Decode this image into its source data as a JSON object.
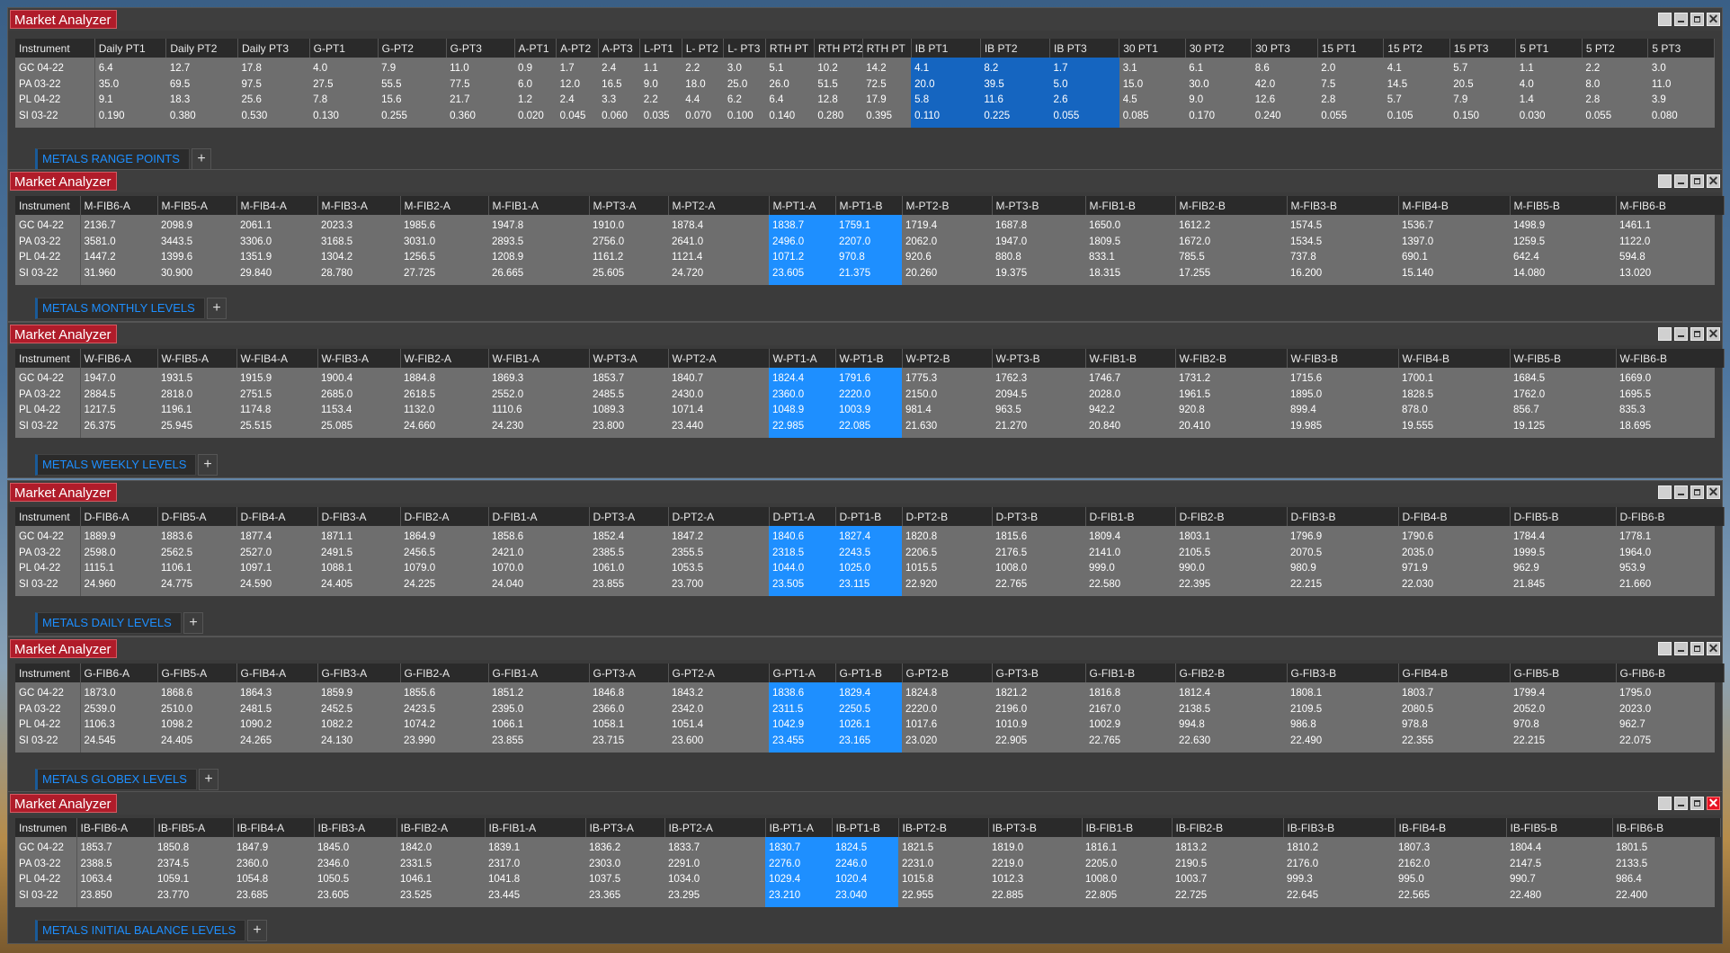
{
  "app_title": "Market Analyzer",
  "instrument_header": "Instrument",
  "instruments": [
    "GC 04-22",
    "PA 03-22",
    "PL 04-22",
    "SI 03-22"
  ],
  "colors": {
    "title_red": "#b01c2a",
    "highlight_blue": "#1e8fff",
    "highlight_dark_blue": "#1565c0",
    "tab_text": "#1e8fff"
  },
  "windows": [
    {
      "title": "Market Analyzer",
      "tab": "METALS RANGE POINTS",
      "instrument_header": "Instrument",
      "columns": [
        "Daily PT1",
        "Daily PT2",
        "Daily PT3",
        "G-PT1",
        "G-PT2",
        "G-PT3",
        "A-PT1",
        "A-PT2",
        "A-PT3",
        "L-PT1",
        "L- PT2",
        "L- PT3",
        "RTH PT",
        "RTH PT2",
        "RTH PT",
        "IB PT1",
        "IB PT2",
        "IB PT3",
        "30 PT1",
        "30 PT2",
        "30 PT3",
        "15 PT1",
        "15 PT2",
        "15 PT3",
        "5 PT1",
        "5 PT2",
        "5 PT3"
      ],
      "highlight_cols": [
        15,
        16,
        17
      ],
      "rows": [
        [
          "GC 04-22",
          "6.4",
          "12.7",
          "17.8",
          "4.0",
          "7.9",
          "11.0",
          "0.9",
          "1.7",
          "2.4",
          "1.1",
          "2.2",
          "3.0",
          "5.1",
          "10.2",
          "14.2",
          "4.1",
          "8.2",
          "1.7",
          "3.1",
          "6.1",
          "8.6",
          "2.0",
          "4.1",
          "5.7",
          "1.1",
          "2.2",
          "3.0"
        ],
        [
          "PA 03-22",
          "35.0",
          "69.5",
          "97.5",
          "27.5",
          "55.5",
          "77.5",
          "6.0",
          "12.0",
          "16.5",
          "9.0",
          "18.0",
          "25.0",
          "26.0",
          "51.5",
          "72.5",
          "20.0",
          "39.5",
          "5.0",
          "15.0",
          "30.0",
          "42.0",
          "7.5",
          "14.5",
          "20.5",
          "4.0",
          "8.0",
          "11.0"
        ],
        [
          "PL 04-22",
          "9.1",
          "18.3",
          "25.6",
          "7.8",
          "15.6",
          "21.7",
          "1.2",
          "2.4",
          "3.3",
          "2.2",
          "4.4",
          "6.2",
          "6.4",
          "12.8",
          "17.9",
          "5.8",
          "11.6",
          "2.6",
          "4.5",
          "9.0",
          "12.6",
          "2.8",
          "5.7",
          "7.9",
          "1.4",
          "2.8",
          "3.9"
        ],
        [
          "SI 03-22",
          "0.190",
          "0.380",
          "0.530",
          "0.130",
          "0.255",
          "0.360",
          "0.020",
          "0.045",
          "0.060",
          "0.035",
          "0.070",
          "0.100",
          "0.140",
          "0.280",
          "0.395",
          "0.110",
          "0.225",
          "0.055",
          "0.085",
          "0.170",
          "0.240",
          "0.055",
          "0.105",
          "0.150",
          "0.030",
          "0.055",
          "0.080"
        ]
      ]
    },
    {
      "title": "Market Analyzer",
      "tab": "METALS MONTHLY LEVELS",
      "instrument_header": "Instrument",
      "columns": [
        "M-FIB6-A",
        "M-FIB5-A",
        "M-FIB4-A",
        "M-FIB3-A",
        "M-FIB2-A",
        "M-FIB1-A",
        "M-PT3-A",
        "M-PT2-A",
        "M-PT1-A",
        "M-PT1-B",
        "M-PT2-B",
        "M-PT3-B",
        "M-FIB1-B",
        "M-FIB2-B",
        "M-FIB3-B",
        "M-FIB4-B",
        "M-FIB5-B",
        "M-FIB6-B"
      ],
      "highlight_cols": [
        8,
        9
      ],
      "rows": [
        [
          "GC 04-22",
          "2136.7",
          "2098.9",
          "2061.1",
          "2023.3",
          "1985.6",
          "1947.8",
          "1910.0",
          "1878.4",
          "1838.7",
          "1759.1",
          "1719.4",
          "1687.8",
          "1650.0",
          "1612.2",
          "1574.5",
          "1536.7",
          "1498.9",
          "1461.1"
        ],
        [
          "PA 03-22",
          "3581.0",
          "3443.5",
          "3306.0",
          "3168.5",
          "3031.0",
          "2893.5",
          "2756.0",
          "2641.0",
          "2496.0",
          "2207.0",
          "2062.0",
          "1947.0",
          "1809.5",
          "1672.0",
          "1534.5",
          "1397.0",
          "1259.5",
          "1122.0"
        ],
        [
          "PL 04-22",
          "1447.2",
          "1399.6",
          "1351.9",
          "1304.2",
          "1256.5",
          "1208.9",
          "1161.2",
          "1121.4",
          "1071.2",
          "970.8",
          "920.6",
          "880.8",
          "833.1",
          "785.5",
          "737.8",
          "690.1",
          "642.4",
          "594.8"
        ],
        [
          "SI 03-22",
          "31.960",
          "30.900",
          "29.840",
          "28.780",
          "27.725",
          "26.665",
          "25.605",
          "24.720",
          "23.605",
          "21.375",
          "20.260",
          "19.375",
          "18.315",
          "17.255",
          "16.200",
          "15.140",
          "14.080",
          "13.020"
        ]
      ]
    },
    {
      "title": "Market Analyzer",
      "tab": "METALS WEEKLY LEVELS",
      "instrument_header": "Instrument",
      "columns": [
        "W-FIB6-A",
        "W-FIB5-A",
        "W-FIB4-A",
        "W-FIB3-A",
        "W-FIB2-A",
        "W-FIB1-A",
        "W-PT3-A",
        "W-PT2-A",
        "W-PT1-A",
        "W-PT1-B",
        "W-PT2-B",
        "W-PT3-B",
        "W-FIB1-B",
        "W-FIB2-B",
        "W-FIB3-B",
        "W-FIB4-B",
        "W-FIB5-B",
        "W-FIB6-B"
      ],
      "highlight_cols": [
        8,
        9
      ],
      "rows": [
        [
          "GC 04-22",
          "1947.0",
          "1931.5",
          "1915.9",
          "1900.4",
          "1884.8",
          "1869.3",
          "1853.7",
          "1840.7",
          "1824.4",
          "1791.6",
          "1775.3",
          "1762.3",
          "1746.7",
          "1731.2",
          "1715.6",
          "1700.1",
          "1684.5",
          "1669.0"
        ],
        [
          "PA 03-22",
          "2884.5",
          "2818.0",
          "2751.5",
          "2685.0",
          "2618.5",
          "2552.0",
          "2485.5",
          "2430.0",
          "2360.0",
          "2220.0",
          "2150.0",
          "2094.5",
          "2028.0",
          "1961.5",
          "1895.0",
          "1828.5",
          "1762.0",
          "1695.5"
        ],
        [
          "PL 04-22",
          "1217.5",
          "1196.1",
          "1174.8",
          "1153.4",
          "1132.0",
          "1110.6",
          "1089.3",
          "1071.4",
          "1048.9",
          "1003.9",
          "981.4",
          "963.5",
          "942.2",
          "920.8",
          "899.4",
          "878.0",
          "856.7",
          "835.3"
        ],
        [
          "SI 03-22",
          "26.375",
          "25.945",
          "25.515",
          "25.085",
          "24.660",
          "24.230",
          "23.800",
          "23.440",
          "22.985",
          "22.085",
          "21.630",
          "21.270",
          "20.840",
          "20.410",
          "19.985",
          "19.555",
          "19.125",
          "18.695"
        ]
      ]
    },
    {
      "title": "Market Analyzer",
      "tab": "METALS DAILY LEVELS",
      "instrument_header": "Instrument",
      "columns": [
        "D-FIB6-A",
        "D-FIB5-A",
        "D-FIB4-A",
        "D-FIB3-A",
        "D-FIB2-A",
        "D-FIB1-A",
        "D-PT3-A",
        "D-PT2-A",
        "D-PT1-A",
        "D-PT1-B",
        "D-PT2-B",
        "D-PT3-B",
        "D-FIB1-B",
        "D-FIB2-B",
        "D-FIB3-B",
        "D-FIB4-B",
        "D-FIB5-B",
        "D-FIB6-B"
      ],
      "highlight_cols": [
        8,
        9
      ],
      "rows": [
        [
          "GC 04-22",
          "1889.9",
          "1883.6",
          "1877.4",
          "1871.1",
          "1864.9",
          "1858.6",
          "1852.4",
          "1847.2",
          "1840.6",
          "1827.4",
          "1820.8",
          "1815.6",
          "1809.4",
          "1803.1",
          "1796.9",
          "1790.6",
          "1784.4",
          "1778.1"
        ],
        [
          "PA 03-22",
          "2598.0",
          "2562.5",
          "2527.0",
          "2491.5",
          "2456.5",
          "2421.0",
          "2385.5",
          "2355.5",
          "2318.5",
          "2243.5",
          "2206.5",
          "2176.5",
          "2141.0",
          "2105.5",
          "2070.5",
          "2035.0",
          "1999.5",
          "1964.0"
        ],
        [
          "PL 04-22",
          "1115.1",
          "1106.1",
          "1097.1",
          "1088.1",
          "1079.0",
          "1070.0",
          "1061.0",
          "1053.5",
          "1044.0",
          "1025.0",
          "1015.5",
          "1008.0",
          "999.0",
          "990.0",
          "980.9",
          "971.9",
          "962.9",
          "953.9"
        ],
        [
          "SI 03-22",
          "24.960",
          "24.775",
          "24.590",
          "24.405",
          "24.225",
          "24.040",
          "23.855",
          "23.700",
          "23.505",
          "23.115",
          "22.920",
          "22.765",
          "22.580",
          "22.395",
          "22.215",
          "22.030",
          "21.845",
          "21.660"
        ]
      ]
    },
    {
      "title": "Market Analyzer",
      "tab": "METALS GLOBEX LEVELS",
      "instrument_header": "Instrument",
      "columns": [
        "G-FIB6-A",
        "G-FIB5-A",
        "G-FIB4-A",
        "G-FIB3-A",
        "G-FIB2-A",
        "G-FIB1-A",
        "G-PT3-A",
        "G-PT2-A",
        "G-PT1-A",
        "G-PT1-B",
        "G-PT2-B",
        "G-PT3-B",
        "G-FIB1-B",
        "G-FIB2-B",
        "G-FIB3-B",
        "G-FIB4-B",
        "G-FIB5-B",
        "G-FIB6-B"
      ],
      "highlight_cols": [
        8,
        9
      ],
      "rows": [
        [
          "GC 04-22",
          "1873.0",
          "1868.6",
          "1864.3",
          "1859.9",
          "1855.6",
          "1851.2",
          "1846.8",
          "1843.2",
          "1838.6",
          "1829.4",
          "1824.8",
          "1821.2",
          "1816.8",
          "1812.4",
          "1808.1",
          "1803.7",
          "1799.4",
          "1795.0"
        ],
        [
          "PA 03-22",
          "2539.0",
          "2510.0",
          "2481.5",
          "2452.5",
          "2423.5",
          "2395.0",
          "2366.0",
          "2342.0",
          "2311.5",
          "2250.5",
          "2220.0",
          "2196.0",
          "2167.0",
          "2138.5",
          "2109.5",
          "2080.5",
          "2052.0",
          "2023.0"
        ],
        [
          "PL 04-22",
          "1106.3",
          "1098.2",
          "1090.2",
          "1082.2",
          "1074.2",
          "1066.1",
          "1058.1",
          "1051.4",
          "1042.9",
          "1026.1",
          "1017.6",
          "1010.9",
          "1002.9",
          "994.8",
          "986.8",
          "978.8",
          "970.8",
          "962.7"
        ],
        [
          "SI 03-22",
          "24.545",
          "24.405",
          "24.265",
          "24.130",
          "23.990",
          "23.855",
          "23.715",
          "23.600",
          "23.455",
          "23.165",
          "23.020",
          "22.905",
          "22.765",
          "22.630",
          "22.490",
          "22.355",
          "22.215",
          "22.075"
        ]
      ]
    },
    {
      "title": "Market Analyzer",
      "tab": "METALS  INITIAL BALANCE LEVELS",
      "instrument_header": "Instrumen",
      "columns": [
        "IB-FIB6-A",
        "IB-FIB5-A",
        "IB-FIB4-A",
        "IB-FIB3-A",
        "IB-FIB2-A",
        "IB-FIB1-A",
        "IB-PT3-A",
        "IB-PT2-A",
        "IB-PT1-A",
        "IB-PT1-B",
        "IB-PT2-B",
        "IB-PT3-B",
        "IB-FIB1-B",
        "IB-FIB2-B",
        "IB-FIB3-B",
        "IB-FIB4-B",
        "IB-FIB5-B",
        "IB-FIB6-B"
      ],
      "highlight_cols": [
        8,
        9
      ],
      "rows": [
        [
          "GC 04-22",
          "1853.7",
          "1850.8",
          "1847.9",
          "1845.0",
          "1842.0",
          "1839.1",
          "1836.2",
          "1833.7",
          "1830.7",
          "1824.5",
          "1821.5",
          "1819.0",
          "1816.1",
          "1813.2",
          "1810.2",
          "1807.3",
          "1804.4",
          "1801.5"
        ],
        [
          "PA 03-22",
          "2388.5",
          "2374.5",
          "2360.0",
          "2346.0",
          "2331.5",
          "2317.0",
          "2303.0",
          "2291.0",
          "2276.0",
          "2246.0",
          "2231.0",
          "2219.0",
          "2205.0",
          "2190.5",
          "2176.0",
          "2162.0",
          "2147.5",
          "2133.5"
        ],
        [
          "PL 04-22",
          "1063.4",
          "1059.1",
          "1054.8",
          "1050.5",
          "1046.1",
          "1041.8",
          "1037.5",
          "1034.0",
          "1029.4",
          "1020.4",
          "1015.8",
          "1012.3",
          "1008.0",
          "1003.7",
          "999.3",
          "995.0",
          "990.7",
          "986.4"
        ],
        [
          "SI 03-22",
          "23.850",
          "23.770",
          "23.685",
          "23.605",
          "23.525",
          "23.445",
          "23.365",
          "23.295",
          "23.210",
          "23.040",
          "22.955",
          "22.885",
          "22.805",
          "22.725",
          "22.645",
          "22.565",
          "22.480",
          "22.400"
        ]
      ]
    }
  ]
}
